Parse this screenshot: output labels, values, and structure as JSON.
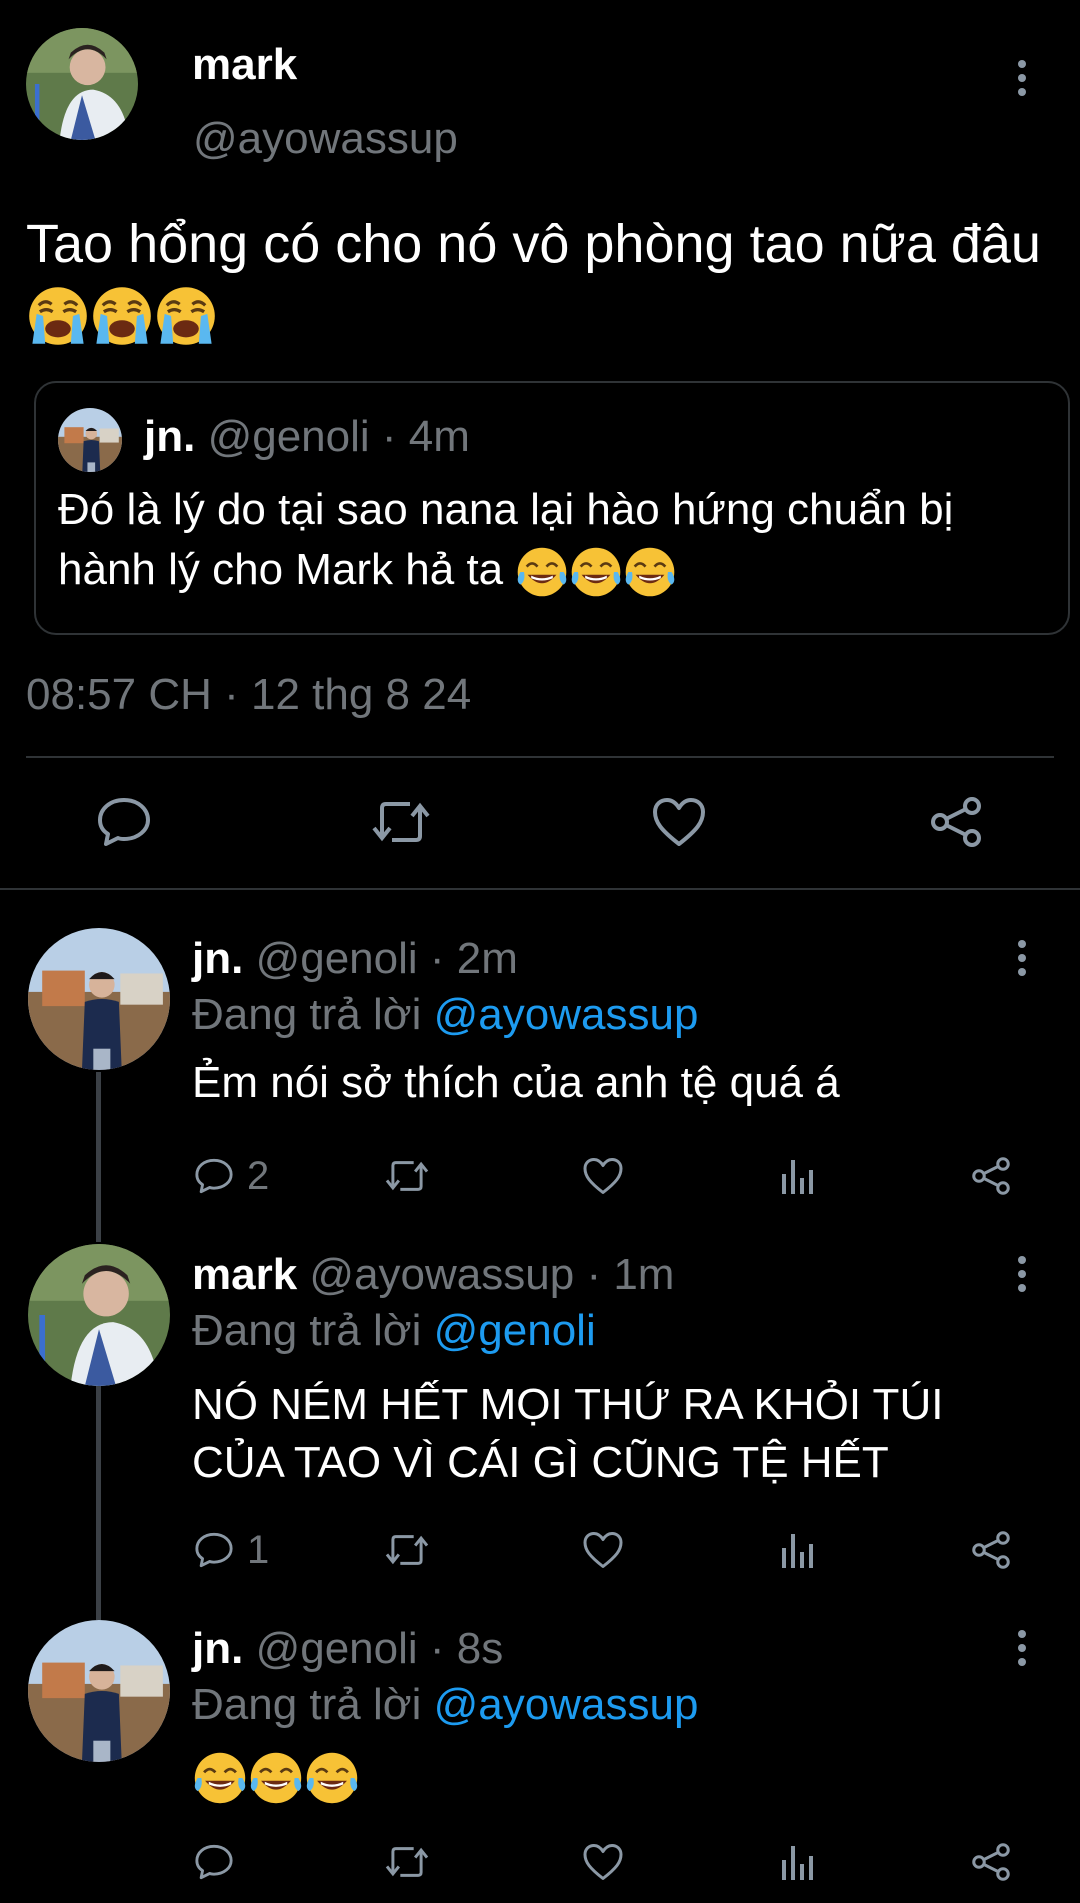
{
  "main_tweet": {
    "display_name": "mark",
    "handle": "@ayowassup",
    "text": "Tao hổng có cho nó vô phòng tao nữa đâu",
    "text_emoji_names": [
      "loudly-crying-face",
      "loudly-crying-face",
      "loudly-crying-face"
    ],
    "timestamp": "08:57 CH · 12 thg 8 24",
    "quoted": {
      "display_name": "jn.",
      "handle": "@genoli",
      "age": "· 4m",
      "text": "Đó là lý do tại sao nana lại hào hứng chuẩn bị hành lý cho Mark hả ta",
      "text_emoji_names": [
        "face-with-tears-of-joy",
        "face-with-tears-of-joy",
        "face-with-tears-of-joy"
      ]
    }
  },
  "replies": [
    {
      "display_name": "jn.",
      "handle": "@genoli",
      "age": "· 2m",
      "replying_prefix": "Đang trả lời",
      "replying_to": "@ayowassup",
      "text": "Ẻm nói sở thích của anh tệ quá á",
      "reply_count": "2"
    },
    {
      "display_name": "mark",
      "handle": "@ayowassup",
      "age": "· 1m",
      "replying_prefix": "Đang trả lời",
      "replying_to": "@genoli",
      "text_line1": "NÓ NÉM HẾT MỌI THỨ RA KHỎI TÚI",
      "text_line2": "CỦA TAO VÌ CÁI GÌ CŨNG TỆ HẾT",
      "reply_count": "1"
    },
    {
      "display_name": "jn.",
      "handle": "@genoli",
      "age": "· 8s",
      "replying_prefix": "Đang trả lời",
      "replying_to": "@ayowassup",
      "text_emoji_names": [
        "face-with-tears-of-joy",
        "face-with-tears-of-joy",
        "face-with-tears-of-joy"
      ],
      "reply_count": ""
    }
  ],
  "colors": {
    "background": "#000000",
    "text": "#e7e9ea",
    "muted": "#71767b",
    "link": "#1d9bf0",
    "divider": "#2f3336"
  }
}
